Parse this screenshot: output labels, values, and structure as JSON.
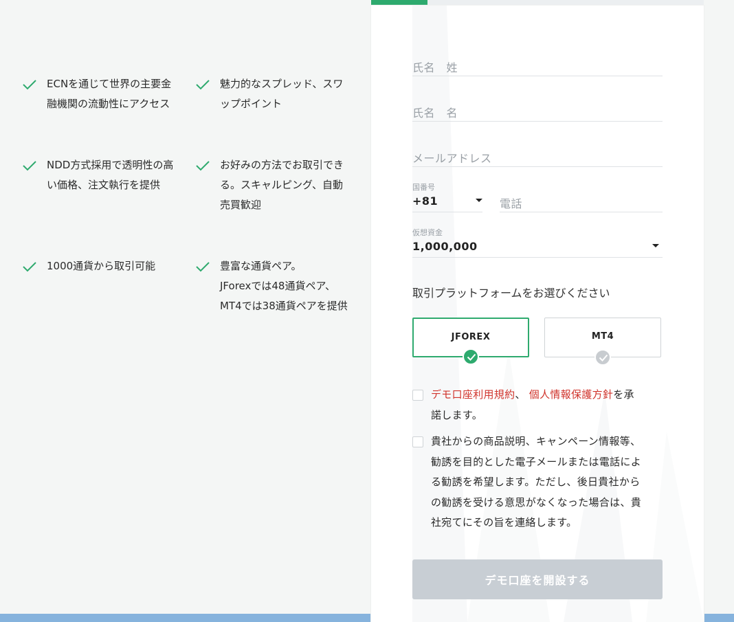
{
  "features": [
    {
      "lines": [
        "ECNを通じて世界の主要金",
        "融機関の流動性にアクセス"
      ]
    },
    {
      "lines": [
        "魅力的なスプレッド、スワ",
        "ップポイント"
      ]
    },
    {
      "lines": [
        "NDD方式採用で透明性の高",
        "い価格、注文執行を提供"
      ]
    },
    {
      "lines": [
        "お好みの方法でお取引でき",
        "る。スキャルピング、自動",
        "売買歓迎"
      ]
    },
    {
      "lines": [
        "1000通貨から取引可能"
      ]
    },
    {
      "lines": [
        "豊富な通貨ペア。",
        "JForexでは48通貨ペア、",
        "MT4では38通貨ペアを提供"
      ]
    }
  ],
  "form": {
    "progress": 0.17,
    "last_name_placeholder": "氏名　姓",
    "first_name_placeholder": "氏名　名",
    "email_placeholder": "メールアドレス",
    "country_code_label": "国番号",
    "country_code_value": "+81",
    "phone_placeholder": "電話",
    "virtual_funds_label": "仮想資金",
    "virtual_funds_value": "1,000,000",
    "platform_title": "取引プラットフォームをお選びください",
    "platforms": [
      {
        "label": "JFOREX",
        "selected": true
      },
      {
        "label": "MT4",
        "selected": false
      }
    ],
    "consent1": {
      "link1": "デモ口座利用規約",
      "sep": "、 ",
      "link2": "個人情報保護方針",
      "rest1": "を承",
      "rest2": "諾します。"
    },
    "consent2_lines": [
      "貴社からの商品説明、キャンペーン情報等、",
      "勧誘を目的とした電子メールまたは電話によ",
      "る勧誘を希望します。ただし、後日貴社から",
      "の勧誘を受ける意思がなくなった場合は、貴",
      "社宛てにその旨を連絡します。"
    ],
    "submit_label": "デモ口座を開設する"
  },
  "colors": {
    "accent": "#2eaa6e",
    "link": "#d0342c",
    "disabled_button": "#c8ced4",
    "band": "#86b3dd"
  }
}
